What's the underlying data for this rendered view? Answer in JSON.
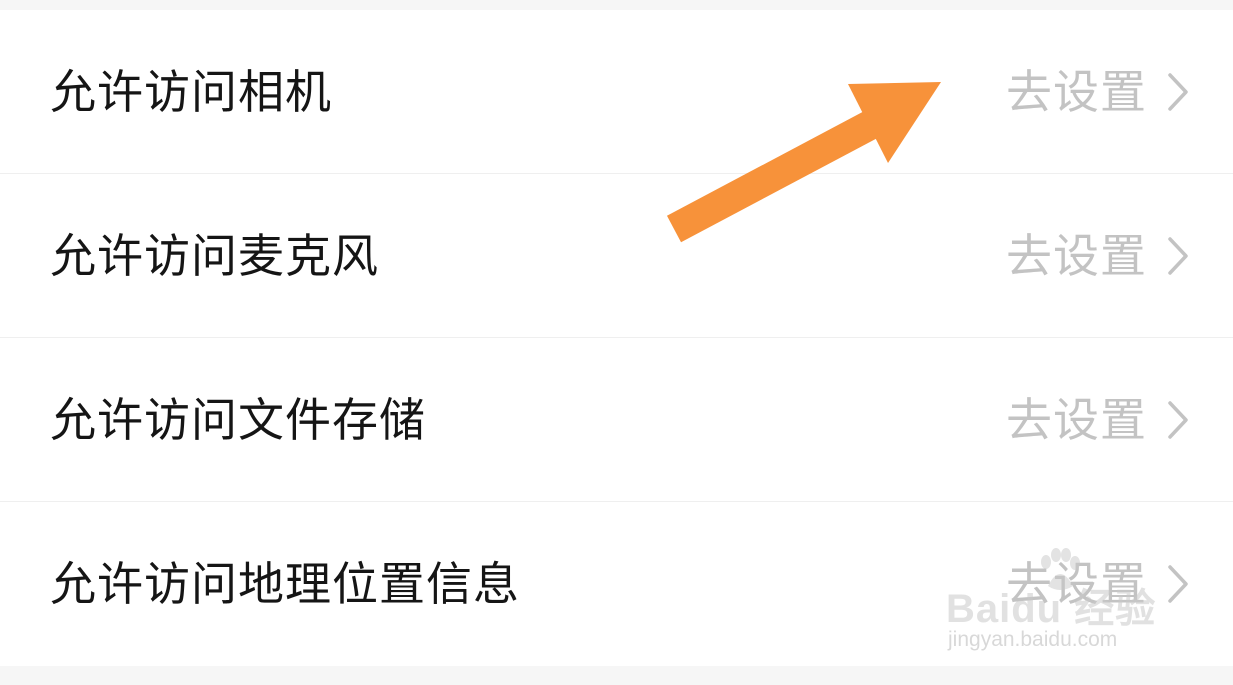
{
  "permissions": {
    "items": [
      {
        "label": "允许访问相机",
        "action": "去设置"
      },
      {
        "label": "允许访问麦克风",
        "action": "去设置"
      },
      {
        "label": "允许访问文件存储",
        "action": "去设置"
      },
      {
        "label": "允许访问地理位置信息",
        "action": "去设置"
      }
    ]
  },
  "icons": {
    "chevron": "chevron-right-icon",
    "annotation": "arrow-annotation-icon",
    "watermark": "baidu-paw-icon"
  },
  "colors": {
    "background": "#f6f6f6",
    "row_background": "#ffffff",
    "label_text": "#151515",
    "action_text": "#c3c3c3",
    "arrow": "#f7923a"
  },
  "watermark": {
    "brand": "Baidu 经验",
    "url": "jingyan.baidu.com"
  }
}
